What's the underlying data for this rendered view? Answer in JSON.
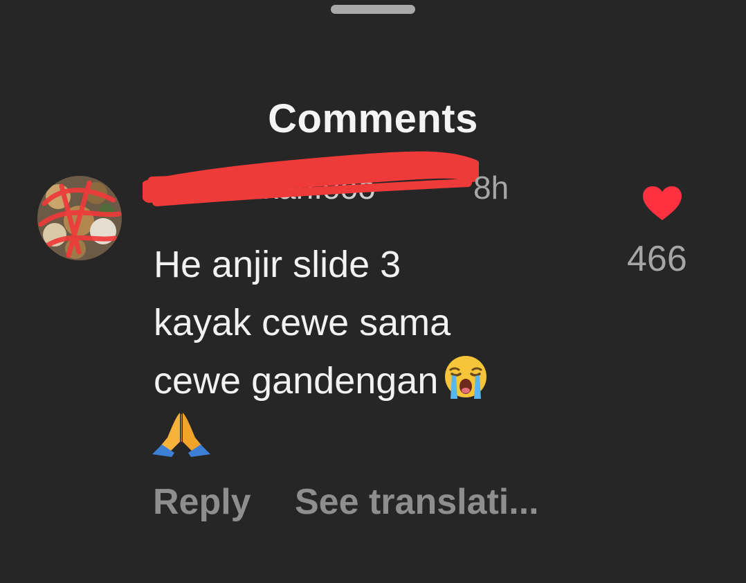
{
  "sheet": {
    "title": "Comments"
  },
  "comment": {
    "username": "cakamakan.ooo",
    "time_ago": "8h",
    "text": "He anjir slide 3\nkayak cewe sama\ncewe gandengan",
    "like_count": "466",
    "liked": true,
    "emojis": [
      "loudly-crying-face",
      "folded-hands"
    ],
    "actions": {
      "reply": "Reply",
      "see_translation": "See translati..."
    }
  },
  "colors": {
    "background": "#262626",
    "heart": "#ff3040",
    "redaction": "#ef3a3a",
    "secondary_text": "#a6a6a6"
  }
}
